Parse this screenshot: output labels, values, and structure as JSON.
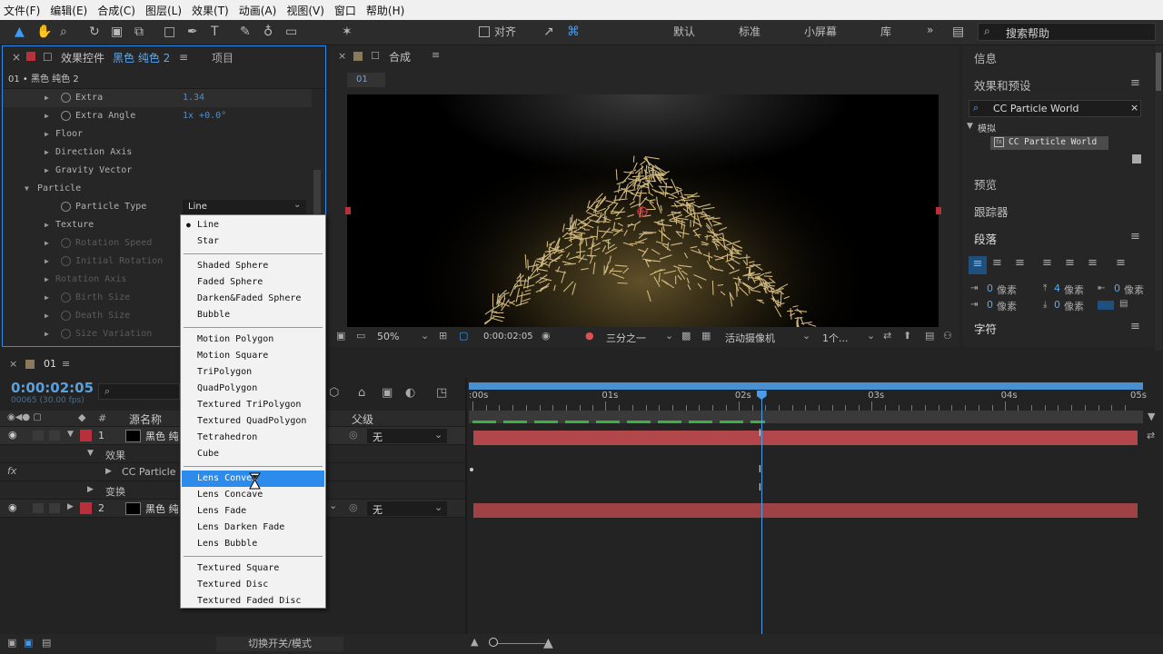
{
  "menu": [
    "文件(F)",
    "编辑(E)",
    "合成(C)",
    "图层(L)",
    "效果(T)",
    "动画(A)",
    "视图(V)",
    "窗口",
    "帮助(H)"
  ],
  "toolbar": {
    "snap": "对齐",
    "workspaces": [
      "默认",
      "标准",
      "小屏幕",
      "库"
    ],
    "search_placeholder": "搜索帮助"
  },
  "effect_panel": {
    "tab_prefix": "效果控件",
    "tab_layer": "黑色 纯色 2",
    "tab_project": "项目",
    "layer_path": "01 • 黑色 纯色 2",
    "rows": [
      {
        "name": "Extra",
        "value": "1.34",
        "stopwatch": true,
        "expanded": false,
        "dim": false
      },
      {
        "name": "Extra Angle",
        "value": "1x +0.0°",
        "stopwatch": true,
        "expanded": false,
        "dim": false
      },
      {
        "name": "Floor",
        "value": "",
        "stopwatch": false,
        "expanded": false,
        "dim": false
      },
      {
        "name": "Direction Axis",
        "value": "",
        "stopwatch": false,
        "expanded": false,
        "dim": false
      },
      {
        "name": "Gravity Vector",
        "value": "",
        "stopwatch": false,
        "expanded": false,
        "dim": false
      },
      {
        "name": "Particle",
        "value": "",
        "stopwatch": false,
        "expanded": true,
        "dim": false
      },
      {
        "name": "Particle Type",
        "value": "Line",
        "stopwatch": true,
        "expanded": false,
        "dim": false
      },
      {
        "name": "Texture",
        "value": "",
        "stopwatch": false,
        "expanded": false,
        "dim": false
      },
      {
        "name": "Rotation Speed",
        "value": "",
        "stopwatch": true,
        "expanded": false,
        "dim": true
      },
      {
        "name": "Initial Rotation",
        "value": "",
        "stopwatch": true,
        "expanded": false,
        "dim": true
      },
      {
        "name": "Rotation Axis",
        "value": "",
        "stopwatch": false,
        "expanded": false,
        "dim": true
      },
      {
        "name": "Birth Size",
        "value": "",
        "stopwatch": true,
        "expanded": false,
        "dim": true
      },
      {
        "name": "Death Size",
        "value": "",
        "stopwatch": true,
        "expanded": false,
        "dim": true
      },
      {
        "name": "Size Variation",
        "value": "",
        "stopwatch": true,
        "expanded": false,
        "dim": true
      }
    ]
  },
  "dropdown": {
    "groups": [
      [
        "Line",
        "Star"
      ],
      [
        "Shaded Sphere",
        "Faded Sphere",
        "Darken&Faded Sphere",
        "Bubble"
      ],
      [
        "Motion Polygon",
        "Motion Square",
        "TriPolygon",
        "QuadPolygon",
        "Textured TriPolygon",
        "Textured QuadPolygon",
        "Tetrahedron",
        "Cube"
      ],
      [
        "Lens Convex",
        "Lens Concave",
        "Lens Fade",
        "Lens Darken Fade",
        "Lens Bubble"
      ],
      [
        "Textured Square",
        "Textured Disc",
        "Textured Faded Disc"
      ]
    ],
    "checked": "Line",
    "highlighted": "Lens Convex"
  },
  "comp": {
    "tab": "合成",
    "comp_name": "01",
    "zoom": "50%",
    "timecode": "0:00:02:05",
    "resolution": "三分之一",
    "camera": "活动摄像机",
    "views": "1个..."
  },
  "right_panel": {
    "info": "信息",
    "effects_presets": "效果和预设",
    "search_value": "CC Particle World",
    "category": "模拟",
    "result": "CC Particle World",
    "preview": "预览",
    "tracker": "跟踪器",
    "paragraph": "段落",
    "spacing_unit": "像素",
    "sp_left": "0",
    "sp_right": "0",
    "sp_first": "0",
    "sp_before": "4",
    "sp_after": "0",
    "character": "字符"
  },
  "timeline": {
    "tab": "01",
    "timecode": "0:00:02:05",
    "fps": "00065 (30.00 fps)",
    "col_num": "#",
    "col_name": "源名称",
    "col_parent": "父级",
    "parent_none": "无",
    "layers": [
      {
        "num": "1",
        "name": "黑色 纯色 2"
      },
      {
        "num": "2",
        "name": "黑色 纯色 1"
      }
    ],
    "sub_effects": "效果",
    "sub_effect_name": "CC Particle World",
    "sub_transform": "变换",
    "ticks": [
      ":00s",
      "01s",
      "02s",
      "03s",
      "04s",
      "05s"
    ],
    "playhead_seconds": 2.17,
    "bottom_label": "切换开关/模式"
  },
  "colors": {
    "accent": "#2d8ceb",
    "layer_label": "#b8313a",
    "bar": "#9e4246",
    "timecode": "#5aa0dc"
  }
}
